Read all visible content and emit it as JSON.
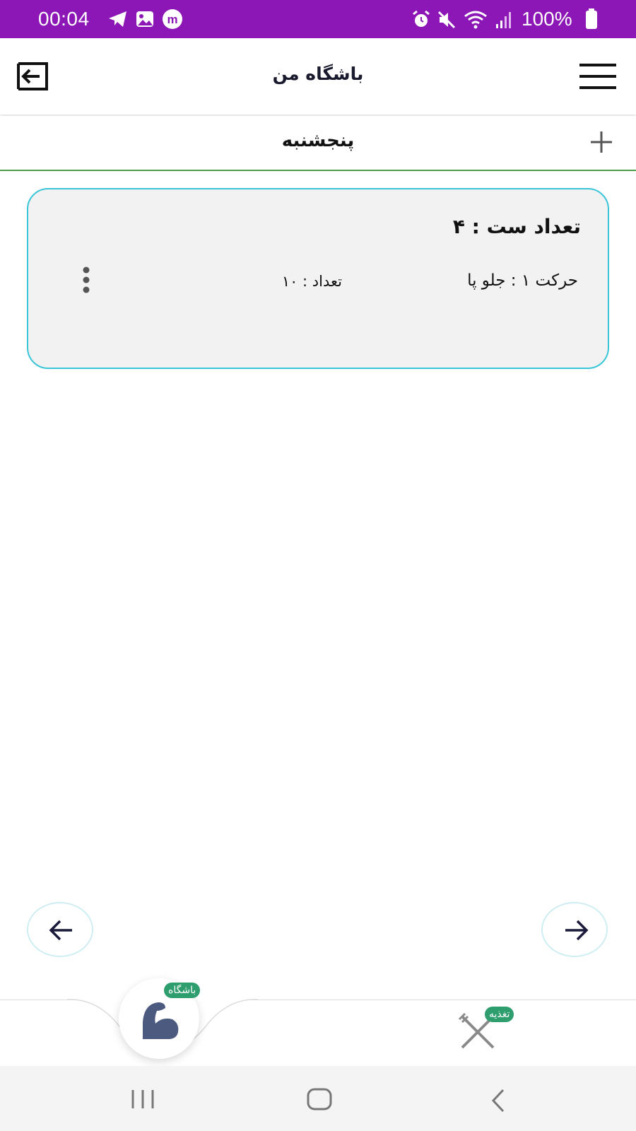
{
  "status_bar": {
    "time": "00:04",
    "battery": "100%",
    "background_color": "#8d17b6",
    "left_icons": [
      "telegram-icon",
      "gallery-icon",
      "messenger-m-icon"
    ],
    "right_icons": [
      "alarm-icon",
      "mute-icon",
      "wifi-icon",
      "signal-icon",
      "battery-icon"
    ]
  },
  "app_bar": {
    "title": "باشگاه من",
    "left_icon": "exit-icon",
    "right_icon": "hamburger-menu-icon"
  },
  "day": {
    "title": "پنجشنبه",
    "add_icon": "plus-icon"
  },
  "workout_card": {
    "set_count": "تعداد ست : ۴",
    "exercises": [
      {
        "move": "حرکت ۱ : جلو پا",
        "reps": "تعداد : ۱۰"
      }
    ],
    "more_icon": "more-vertical-icon",
    "border_color": "#3ac6d8"
  },
  "navigation": {
    "prev_icon": "arrow-left-icon",
    "next_icon": "arrow-right-icon"
  },
  "bottom_tabs": [
    {
      "label": "باشگاه",
      "icon": "flexed-arm-icon",
      "active": true
    },
    {
      "label": "تغذیه",
      "icon": "fork-knife-icon",
      "active": false
    }
  ],
  "badge_color": "#2e9e6e",
  "system_nav": [
    "recent-apps-icon",
    "home-icon",
    "back-icon"
  ]
}
